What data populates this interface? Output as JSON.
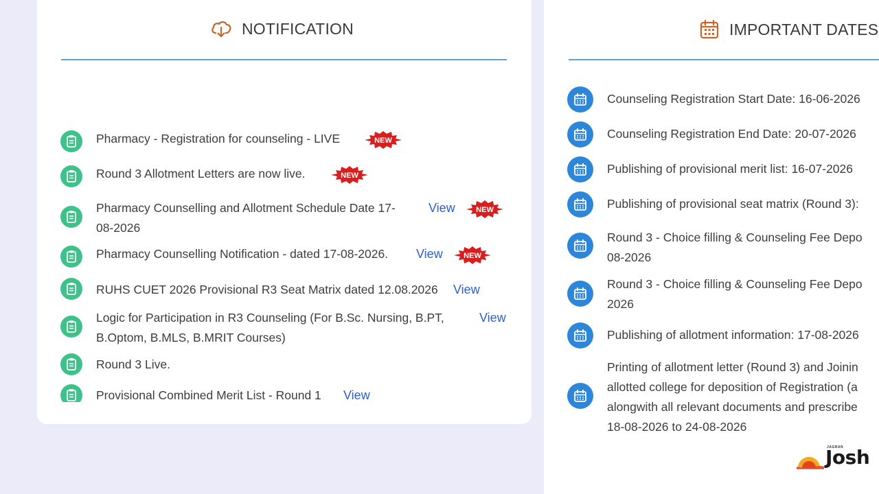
{
  "notification_panel": {
    "title": "NOTIFICATION",
    "icon": "cloud-download-icon",
    "items": [
      {
        "text": "Pharmacy - Registration for counseling - LIVE",
        "view": "",
        "new": "NEW"
      },
      {
        "text": "Round 3 Allotment Letters are now live.",
        "view": "",
        "new": "NEW"
      },
      {
        "text_line1": "Pharmacy Counselling and Allotment Schedule Date 17-",
        "text_line2": "08-2026",
        "view": "View",
        "new": "NEW"
      },
      {
        "text": "Pharmacy Counselling Notification - dated 17-08-2026.",
        "view": "View",
        "new": "NEW"
      },
      {
        "text": "RUHS CUET 2026 Provisional R3 Seat Matrix dated 12.08.2026",
        "view": "View",
        "new": ""
      },
      {
        "text_line1": "Logic for Participation in R3 Counseling (For B.Sc. Nursing, B.PT,",
        "text_line2": "B.Optom, B.MLS, B.MRIT Courses)",
        "view": "View",
        "new": ""
      },
      {
        "text": "Round 3 Live.",
        "view": "",
        "new": ""
      },
      {
        "text": "Provisional Combined Merit List - Round 1",
        "view": "View",
        "new": ""
      }
    ]
  },
  "dates_panel": {
    "title": "IMPORTANT DATES",
    "icon": "calendar-icon",
    "items": [
      {
        "line1": "Counseling Registration Start Date: 16-06-2026"
      },
      {
        "line1": "Counseling Registration End Date: 20-07-2026"
      },
      {
        "line1": "Publishing of provisional merit list: 16-07-2026"
      },
      {
        "line1": "Publishing of provisional seat matrix (Round 3):"
      },
      {
        "line1": "Round 3 - Choice filling & Counseling Fee Depo",
        "line2": "08-2026"
      },
      {
        "line1": "Round 3 - Choice filling & Counseling Fee Depo",
        "line2": "2026"
      },
      {
        "line1": "Publishing of allotment information: 17-08-2026"
      },
      {
        "line1": "Printing of allotment letter (Round 3) and Joinin",
        "line2": "allotted college for deposition of Registration (a",
        "line3": "alongwith all relevant documents and prescribe",
        "line4": "18-08-2026 to 24-08-2026"
      }
    ]
  },
  "logo": {
    "small": "JAGRAN",
    "main": "Josh"
  },
  "colors": {
    "notification_icon": "#3fc28a",
    "date_icon": "#2e86d8",
    "link": "#2a5fd8",
    "accent_header": "#c8642a",
    "divider": "#5a9fd8",
    "new_badge": "#d81e1e"
  }
}
